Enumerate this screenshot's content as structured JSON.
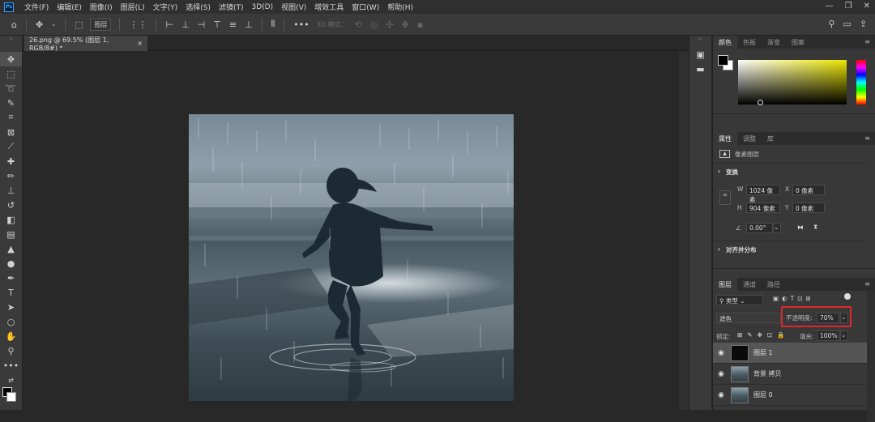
{
  "app": {
    "logo": "Ps"
  },
  "menu": [
    "文件(F)",
    "编辑(E)",
    "图像(I)",
    "图层(L)",
    "文字(Y)",
    "选择(S)",
    "滤镜(T)",
    "3D(D)",
    "视图(V)",
    "增效工具",
    "窗口(W)",
    "帮助(H)"
  ],
  "options_bar": {
    "layer_select": "图层",
    "mode_3d": "3D 模式："
  },
  "document": {
    "tab_title": "26.png @ 69.5% (图层 1, RGB/8#) *",
    "close": "×"
  },
  "color_panel": {
    "tabs": [
      "颜色",
      "色板",
      "渐变",
      "图案"
    ]
  },
  "properties_panel": {
    "tabs": [
      "属性",
      "调整",
      "库"
    ],
    "kind": "像素图层",
    "transform_title": "变换",
    "w_label": "W",
    "w_value": "1024 像素",
    "h_label": "H",
    "h_value": "904 像素",
    "x_label": "X",
    "x_value": "0 像素",
    "y_label": "Y",
    "y_value": "0 像素",
    "angle_value": "0.00°",
    "align_title": "对齐并分布"
  },
  "layers_panel": {
    "tabs": [
      "图层",
      "通道",
      "路径"
    ],
    "filter_kind": "类型",
    "blend_mode": "滤色",
    "opacity_label": "不透明度:",
    "opacity_value": "70%",
    "lock_label": "锁定:",
    "fill_label": "填充:",
    "fill_value": "100%",
    "layers": [
      {
        "name": "图层 1",
        "selected": true
      },
      {
        "name": "背景 拷贝",
        "selected": false
      },
      {
        "name": "图层 0",
        "selected": false
      }
    ]
  },
  "colors": {
    "accent": "#31a8ff",
    "highlight_box": "#e0262b"
  }
}
